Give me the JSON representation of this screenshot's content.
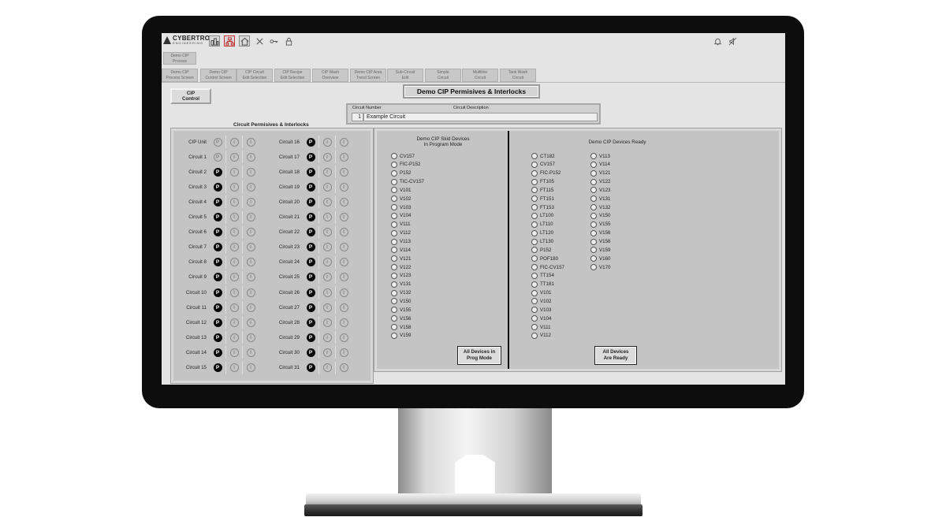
{
  "app": {
    "logo_text": "CYBERTROL",
    "logo_sub": "ENGINEERING"
  },
  "toolbar": {
    "left_icons": [
      "plant-icon",
      "network-icon",
      "home-icon",
      "close-icon",
      "key-icon",
      "lock-icon"
    ],
    "right_icons": [
      "bell-icon",
      "alarm-silence-icon"
    ]
  },
  "tabs_row1": [
    {
      "label": "Demo CIP\nProcess"
    }
  ],
  "tabs_row2": [
    {
      "label": "Demo CIP\nProcess Screen"
    },
    {
      "label": "Demo CIP\nControl Screen"
    },
    {
      "label": "CIP Circuit\nEdit Selection"
    },
    {
      "label": "CIP Recipe\nEdit Selection"
    },
    {
      "label": "CIP Wash\nOverview"
    },
    {
      "label": "Demo CIP Area\nTrend Screen"
    },
    {
      "label": "Sub-Circuit\nEdit"
    },
    {
      "label": "Simple\nCircuit"
    },
    {
      "label": "Multiline\nCircuit"
    },
    {
      "label": "Tank Wash\nCircuit"
    }
  ],
  "cip_control_button": "CIP\nControl",
  "page_title": "Demo CIP Permisives & Interlocks",
  "circuit_info": {
    "number_header": "Circuit Number",
    "description_header": "Circuit Description",
    "number": "1",
    "description": "Example Circuit"
  },
  "permissives": {
    "title": "Circuit Permisives & Interlocks",
    "indicator_p": "P",
    "indicator_i": "I",
    "left_column": [
      {
        "label": "CIP Unit",
        "p_active": false
      },
      {
        "label": "Circuit 1",
        "p_active": false
      },
      {
        "label": "Circuit 2",
        "p_active": true
      },
      {
        "label": "Circuit 3",
        "p_active": true
      },
      {
        "label": "Circuit 4",
        "p_active": true
      },
      {
        "label": "Circuit 5",
        "p_active": true
      },
      {
        "label": "Circuit 6",
        "p_active": true
      },
      {
        "label": "Circuit 7",
        "p_active": true
      },
      {
        "label": "Circuit 8",
        "p_active": true
      },
      {
        "label": "Circuit 9",
        "p_active": true
      },
      {
        "label": "Circuit 10",
        "p_active": true
      },
      {
        "label": "Circuit 11",
        "p_active": true
      },
      {
        "label": "Circuit 12",
        "p_active": true
      },
      {
        "label": "Circuit 13",
        "p_active": true
      },
      {
        "label": "Circuit 14",
        "p_active": true
      },
      {
        "label": "Circuit 15",
        "p_active": true
      }
    ],
    "right_column": [
      {
        "label": "Circuit 16",
        "p_active": true
      },
      {
        "label": "Circuit 17",
        "p_active": true
      },
      {
        "label": "Circuit 18",
        "p_active": true
      },
      {
        "label": "Circuit 19",
        "p_active": true
      },
      {
        "label": "Circuit 20",
        "p_active": true
      },
      {
        "label": "Circuit 21",
        "p_active": true
      },
      {
        "label": "Circuit 22",
        "p_active": true
      },
      {
        "label": "Circuit 23",
        "p_active": true
      },
      {
        "label": "Circuit 24",
        "p_active": true
      },
      {
        "label": "Circuit 25",
        "p_active": true
      },
      {
        "label": "Circuit 26",
        "p_active": true
      },
      {
        "label": "Circuit 27",
        "p_active": true
      },
      {
        "label": "Circuit 28",
        "p_active": true
      },
      {
        "label": "Circuit 29",
        "p_active": true
      },
      {
        "label": "Circuit 30",
        "p_active": true
      },
      {
        "label": "Circuit 31",
        "p_active": true
      }
    ]
  },
  "skid_devices": {
    "title": "Demo CIP Skid Devices\nIn Program Mode",
    "items": [
      "CV157",
      "FIC-P152",
      "P152",
      "TIC-CV157",
      "V101",
      "V102",
      "V103",
      "V104",
      "V111",
      "V112",
      "V113",
      "V114",
      "V121",
      "V122",
      "V123",
      "V131",
      "V132",
      "V150",
      "V155",
      "V156",
      "V158",
      "V159"
    ],
    "button": "All Devices in\nProg Mode"
  },
  "ready_devices": {
    "title": "Demo CIP Devices Ready",
    "col1": [
      "CT182",
      "CV157",
      "FIC-P152",
      "FT105",
      "FT115",
      "FT151",
      "FT153",
      "LT100",
      "LT110",
      "LT120",
      "LT130",
      "P152",
      "POF180",
      "FIC-CV157",
      "TT154",
      "TT181",
      "V101",
      "V102",
      "V103",
      "V104",
      "V111",
      "V112"
    ],
    "col2": [
      "V113",
      "V114",
      "V121",
      "V122",
      "V123",
      "V131",
      "V132",
      "V150",
      "V155",
      "V156",
      "V158",
      "V159",
      "V160",
      "V170"
    ],
    "button": "All Devices\nAre Ready"
  }
}
